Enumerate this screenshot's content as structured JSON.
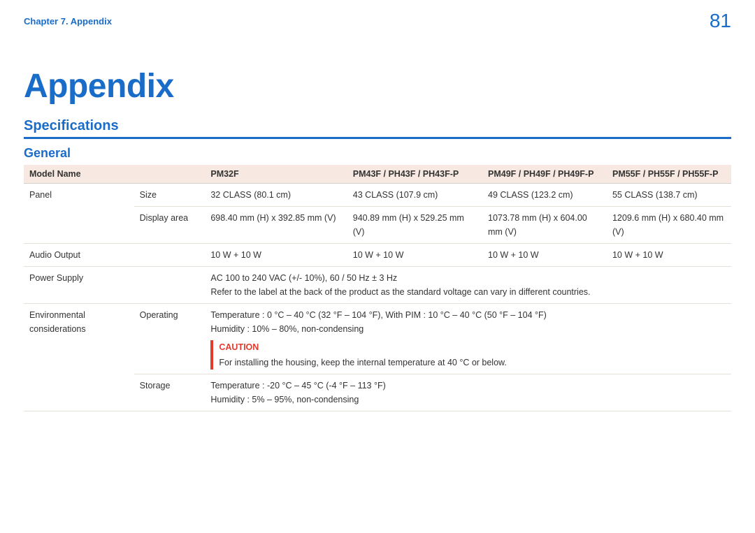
{
  "header": {
    "breadcrumb": "Chapter 7. Appendix",
    "page_number": "81"
  },
  "title": "Appendix",
  "section": "Specifications",
  "subsection": "General",
  "table": {
    "headers": {
      "model_name": "Model Name",
      "m1": "PM32F",
      "m2": "PM43F / PH43F / PH43F-P",
      "m3": "PM49F / PH49F / PH49F-P",
      "m4": "PM55F / PH55F / PH55F-P"
    },
    "panel": {
      "label": "Panel",
      "size_label": "Size",
      "size": {
        "m1": "32 CLASS (80.1 cm)",
        "m2": "43 CLASS (107.9 cm)",
        "m3": "49 CLASS (123.2 cm)",
        "m4": "55 CLASS (138.7 cm)"
      },
      "display_area_label": "Display area",
      "display_area": {
        "m1": "698.40 mm (H) x 392.85 mm (V)",
        "m2": "940.89 mm (H) x 529.25 mm (V)",
        "m3": "1073.78 mm (H) x 604.00 mm (V)",
        "m4": "1209.6 mm (H) x 680.40 mm (V)"
      }
    },
    "audio_output": {
      "label": "Audio Output",
      "m1": "10 W + 10 W",
      "m2": "10 W + 10 W",
      "m3": "10 W + 10 W",
      "m4": "10 W + 10 W"
    },
    "power_supply": {
      "label": "Power Supply",
      "line1": "AC 100 to 240 VAC (+/- 10%), 60 / 50 Hz ± 3 Hz",
      "line2": "Refer to the label at the back of the product as the standard voltage can vary in different countries."
    },
    "env": {
      "label": "Environmental considerations",
      "operating_label": "Operating",
      "operating_line1": "Temperature : 0 °C – 40 °C (32 °F – 104 °F), With PIM : 10 °C – 40 °C (50 °F – 104 °F)",
      "operating_line2": "Humidity : 10% – 80%, non-condensing",
      "caution_label": "CAUTION",
      "caution_text": "For installing the housing, keep the internal temperature at 40 °C or below.",
      "storage_label": "Storage",
      "storage_line1": "Temperature : -20 °C – 45 °C (-4 °F – 113 °F)",
      "storage_line2": "Humidity : 5% – 95%, non-condensing"
    }
  }
}
